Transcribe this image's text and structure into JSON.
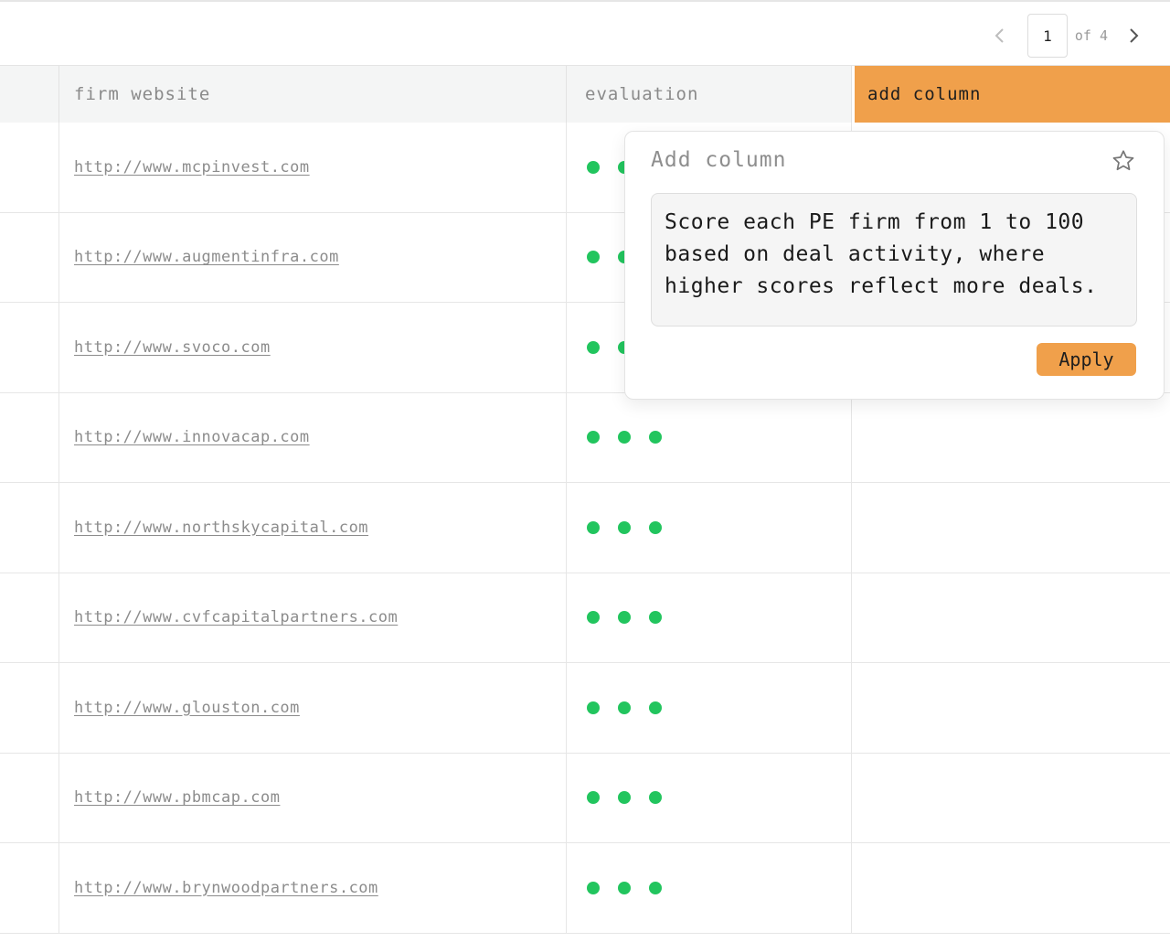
{
  "pagination": {
    "current_page": "1",
    "of_label": "of",
    "total_pages": "4"
  },
  "table": {
    "columns": [
      "firm website",
      "evaluation",
      "add column"
    ],
    "rows": [
      {
        "website": "http://www.mcpinvest.com"
      },
      {
        "website": "http://www.augmentinfra.com"
      },
      {
        "website": "http://www.svoco.com"
      },
      {
        "website": "http://www.innovacap.com"
      },
      {
        "website": "http://www.northskycapital.com"
      },
      {
        "website": "http://www.cvfcapitalpartners.com"
      },
      {
        "website": "http://www.glouston.com"
      },
      {
        "website": "http://www.pbmcap.com"
      },
      {
        "website": "http://www.brynwoodpartners.com"
      }
    ]
  },
  "popover": {
    "title": "Add column",
    "prompt_text": "Score each PE firm from 1 to 100\nbased on deal activity, where\nhigher scores reflect more deals.",
    "apply_label": "Apply"
  },
  "colors": {
    "accent": "#f0a04b",
    "status_dot": "#22c55e"
  },
  "icons": [
    "chevron-left-icon",
    "chevron-right-icon",
    "star-icon"
  ]
}
